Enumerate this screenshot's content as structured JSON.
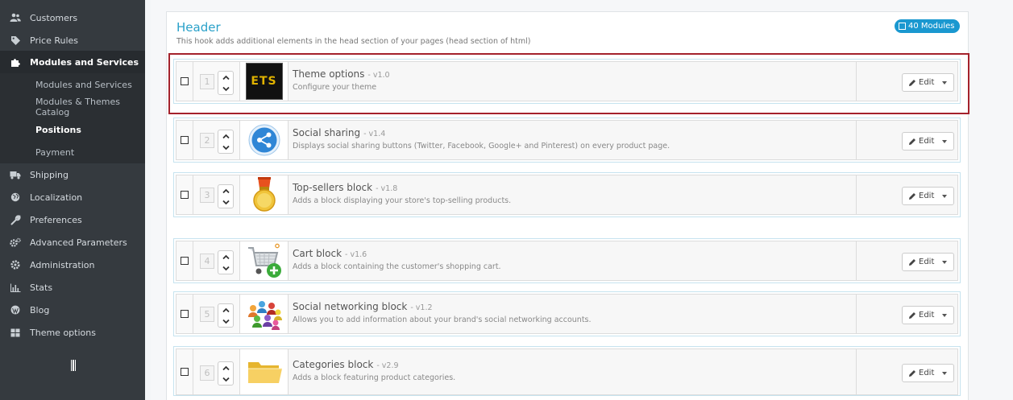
{
  "sidebar": {
    "items": [
      {
        "label": "Customers",
        "icon": "users-icon"
      },
      {
        "label": "Price Rules",
        "icon": "tag-icon"
      },
      {
        "label": "Modules and Services",
        "icon": "puzzle-icon"
      },
      {
        "label": "Shipping",
        "icon": "truck-icon"
      },
      {
        "label": "Localization",
        "icon": "globe-icon"
      },
      {
        "label": "Preferences",
        "icon": "wrench-icon"
      },
      {
        "label": "Advanced Parameters",
        "icon": "cogs-icon"
      },
      {
        "label": "Administration",
        "icon": "gear-icon"
      },
      {
        "label": "Stats",
        "icon": "bar-chart-icon"
      },
      {
        "label": "Blog",
        "icon": "wordpress-icon"
      },
      {
        "label": "Theme options",
        "icon": "grid-icon"
      }
    ],
    "subitems": [
      {
        "label": "Modules and Services"
      },
      {
        "label": "Modules & Themes Catalog"
      },
      {
        "label": "Positions"
      },
      {
        "label": "Payment"
      }
    ]
  },
  "hook": {
    "title": "Header",
    "description": "This hook adds additional elements in the head section of your pages (head section of html)",
    "badge": "40 Modules"
  },
  "modules": [
    {
      "position": "1",
      "name": "Theme options",
      "version": "- v1.0",
      "description": "Configure your theme",
      "logo": "ets-logo-icon",
      "edit": "Edit"
    },
    {
      "position": "2",
      "name": "Social sharing",
      "version": "- v1.4",
      "description": "Displays social sharing buttons (Twitter, Facebook, Google+ and Pinterest) on every product page.",
      "logo": "share-icon",
      "edit": "Edit"
    },
    {
      "position": "3",
      "name": "Top-sellers block",
      "version": "- v1.8",
      "description": "Adds a block displaying your store's top-selling products.",
      "logo": "medal-icon",
      "edit": "Edit"
    },
    {
      "position": "4",
      "name": "Cart block",
      "version": "- v1.6",
      "description": "Adds a block containing the customer's shopping cart.",
      "logo": "cart-add-icon",
      "edit": "Edit"
    },
    {
      "position": "5",
      "name": "Social networking block",
      "version": "- v1.2",
      "description": "Allows you to add information about your brand's social networking accounts.",
      "logo": "people-network-icon",
      "edit": "Edit"
    },
    {
      "position": "6",
      "name": "Categories block",
      "version": "- v2.9",
      "description": "Adds a block featuring product categories.",
      "logo": "folder-icon",
      "edit": "Edit"
    }
  ],
  "logo_text": "ETS",
  "colors": {
    "accent": "#2aa1c9",
    "badge": "#1a98d0",
    "highlight": "#a4222c",
    "sidebar": "#353a3f"
  }
}
